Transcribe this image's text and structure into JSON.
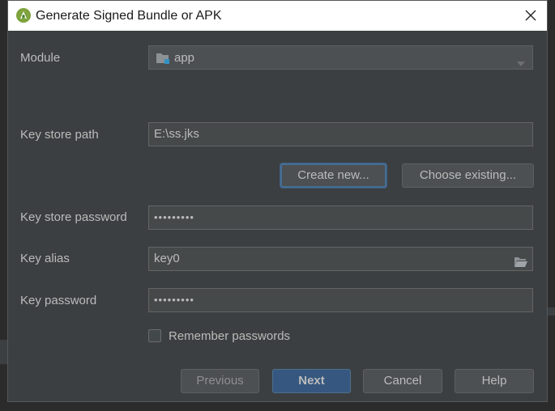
{
  "dialog": {
    "title": "Generate Signed Bundle or APK",
    "logo_icon": "android-studio-icon",
    "close_icon": "close-icon"
  },
  "form": {
    "module": {
      "label": "Module",
      "value": "app",
      "icon": "module-folder-icon"
    },
    "key_store_path": {
      "label": "Key store path",
      "value": "E:\\ss.jks"
    },
    "create_new_label": "Create new...",
    "choose_existing_label": "Choose existing...",
    "key_store_password": {
      "label": "Key store password",
      "value": "•••••••••"
    },
    "key_alias": {
      "label": "Key alias",
      "value": "key0",
      "browse_icon": "folder-open-icon"
    },
    "key_password": {
      "label": "Key password",
      "value": "•••••••••"
    },
    "remember_passwords": {
      "label": "Remember passwords",
      "checked": false
    }
  },
  "footer": {
    "previous_label": "Previous",
    "next_label": "Next",
    "cancel_label": "Cancel",
    "help_label": "Help"
  },
  "colors": {
    "dialog_bg": "#3c3f41",
    "field_bg": "#45494a",
    "primary_button": "#365880",
    "focus_ring": "#466d94",
    "text": "#bbbbbb"
  }
}
